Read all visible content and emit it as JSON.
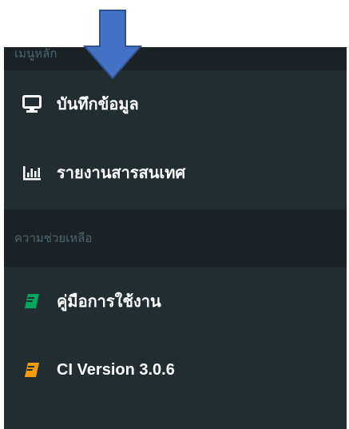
{
  "sidebar": {
    "header_top": "เมนูหลัก",
    "items": [
      {
        "label": "บันทึกข้อมูล",
        "icon": "desktop-icon"
      },
      {
        "label": "รายงานสารสนเทศ",
        "icon": "bar-chart-icon"
      }
    ],
    "header_help": "ความช่วยเหลือ",
    "help_items": [
      {
        "label": "คู่มือการใช้งาน",
        "icon": "book-icon",
        "icon_color": "#00a65a"
      },
      {
        "label": "CI Version 3.0.6",
        "icon": "book-icon",
        "icon_color": "#f39c12"
      }
    ]
  },
  "colors": {
    "panel_bg": "#222d32",
    "header_bg": "#1a2226",
    "header_text": "#4b646f",
    "arrow_fill": "#4472c4"
  }
}
